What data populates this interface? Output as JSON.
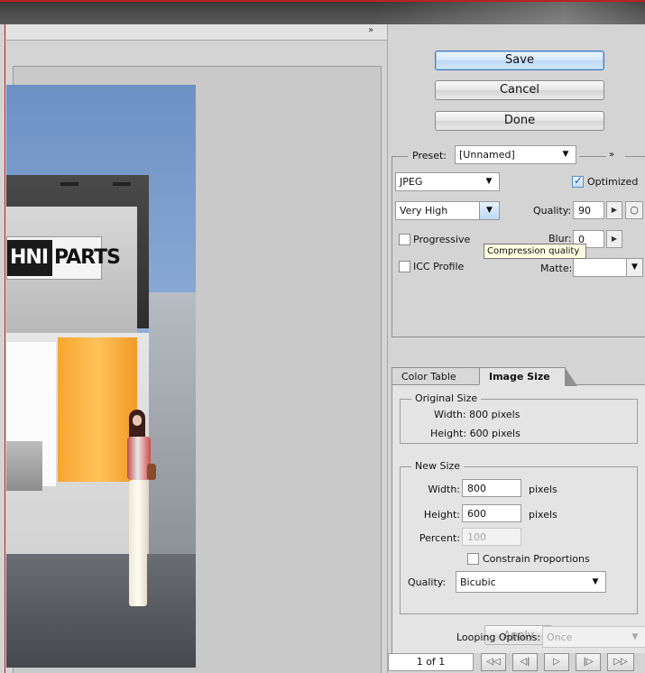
{
  "titlebar": {},
  "preview": {
    "collapse_icon": "double-chevron-right-icon"
  },
  "image_content": {
    "logo_left": "HNI",
    "logo_right": "PARTS"
  },
  "actions": {
    "save_label": "Save",
    "cancel_label": "Cancel",
    "done_label": "Done"
  },
  "settings": {
    "preset_label": "Preset:",
    "preset_value": "[Unnamed]",
    "format_value": "JPEG",
    "optimized_label": "Optimized",
    "optimized_checked": true,
    "quality_preset_value": "Very High",
    "quality_label": "Quality:",
    "quality_value": "90",
    "progressive_label": "Progressive",
    "progressive_checked": false,
    "blur_label": "Blur:",
    "blur_value": "0",
    "icc_label": "ICC Profile",
    "icc_checked": false,
    "matte_label": "Matte:",
    "matte_value": "",
    "tooltip_text": "Compression quality"
  },
  "tabs": [
    {
      "label": "Color Table",
      "active": false
    },
    {
      "label": "Image Size",
      "active": true
    }
  ],
  "image_size": {
    "original_title": "Original Size",
    "original_width_text": "Width: 800 pixels",
    "original_height_text": "Height: 600 pixels",
    "new_title": "New Size",
    "width_label": "Width:",
    "width_value": "800",
    "width_unit": "pixels",
    "height_label": "Height:",
    "height_value": "600",
    "height_unit": "pixels",
    "percent_label": "Percent:",
    "percent_value": "100",
    "constrain_label": "Constrain Proportions",
    "constrain_checked": false,
    "quality_label": "Quality:",
    "quality_value": "Bicubic",
    "apply_label": "Apply"
  },
  "animation": {
    "looping_label": "Looping Options:",
    "looping_value": "Once",
    "frame_count": "1 of 1"
  }
}
